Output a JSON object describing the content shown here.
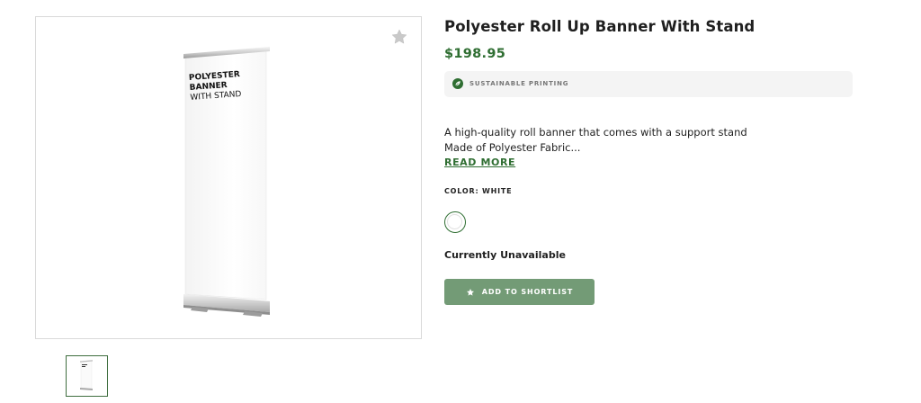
{
  "product": {
    "title": "Polyester Roll Up Banner With Stand",
    "price": "$198.95",
    "sustainability_label": "SUSTAINABLE PRINTING",
    "description_line1": "A high-quality roll banner that comes with a support stand",
    "description_line2": "Made of Polyester Fabric...",
    "read_more_label": "READ MORE",
    "color_label": "COLOR: WHITE",
    "availability": "Currently Unavailable",
    "shortlist_label": "ADD TO SHORTLIST"
  },
  "banner_art": {
    "line1": "POLYESTER",
    "line2": "BANNER",
    "line3": "WITH STAND"
  },
  "colors": {
    "accent": "#2f6e32",
    "button": "#739b76"
  },
  "icons": {
    "favorite": "star-icon",
    "leaf": "leaf-icon",
    "shortlist": "star-icon"
  }
}
